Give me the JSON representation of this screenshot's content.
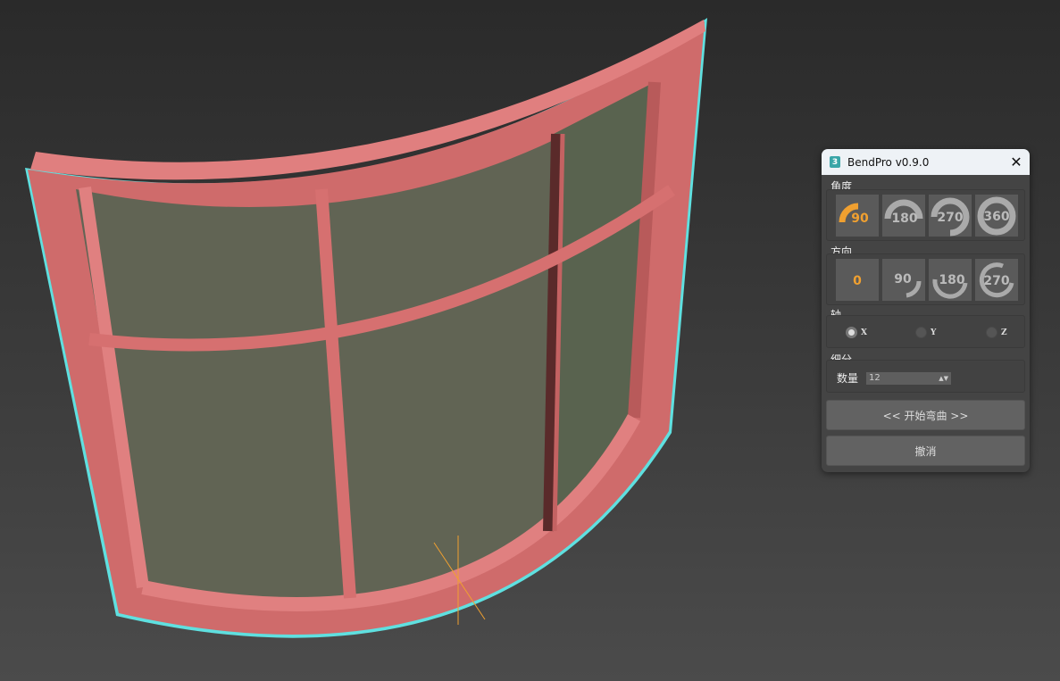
{
  "panel": {
    "title": "BendPro v0.9.0",
    "close": "✕",
    "angle": {
      "label": "角度",
      "buttons": [
        "90",
        "180",
        "270",
        "360"
      ],
      "selected": "90"
    },
    "direction": {
      "label": "方向",
      "buttons": [
        "0",
        "90",
        "180",
        "270"
      ],
      "selected": "0"
    },
    "axis": {
      "label": "轴",
      "options": [
        "X",
        "Y",
        "Z"
      ],
      "selected": "X"
    },
    "subdivision": {
      "label": "细分",
      "count_label": "数量",
      "count_value": "12"
    },
    "start_button": "<< 开始弯曲 >>",
    "cancel_button": "撤消"
  },
  "colors": {
    "accent": "#f0a030",
    "frame": "#d67070",
    "selection": "#5fe0e0"
  }
}
